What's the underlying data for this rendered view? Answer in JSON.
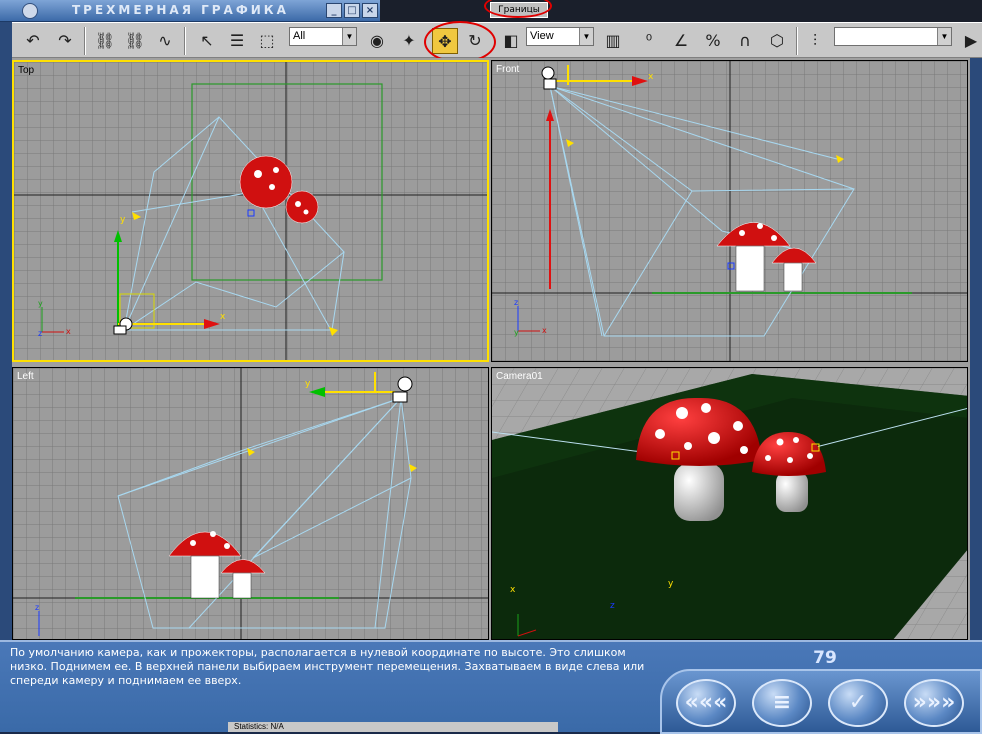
{
  "window": {
    "title": "ТРЕХМЕРНАЯ ГРАФИКА",
    "top_tab": "Границы"
  },
  "toolbar": {
    "selection_filter": "All",
    "ref_coord_system": "View",
    "named_selection": "",
    "active_tool": "select-and-move"
  },
  "viewports": {
    "top": {
      "label": "Top"
    },
    "front": {
      "label": "Front"
    },
    "left": {
      "label": "Left"
    },
    "camera": {
      "label": "Camera01"
    }
  },
  "axes": {
    "x": "x",
    "y": "y",
    "z": "z"
  },
  "panel": {
    "instruction": "По умолчанию камера, как и прожекторы, располагается в нулевой координате по высоте. Это слишком низко. Поднимем ее. В верхней панели выбираем инструмент перемещения. Захватываем в виде слева или спереди камеру и поднимаем ее вверх.",
    "page_number": "79"
  },
  "statusbar": {
    "text": "Statistics: N/A"
  },
  "colors": {
    "viewport_bg": "#9c9c9c",
    "grid": "#7a7a7a",
    "active_border": "#ffe000",
    "highlight_circle": "#e00000",
    "panel_bg": "#3a6aa8",
    "mushroom_cap": "#d01010",
    "ground": "#0c2a0c"
  }
}
